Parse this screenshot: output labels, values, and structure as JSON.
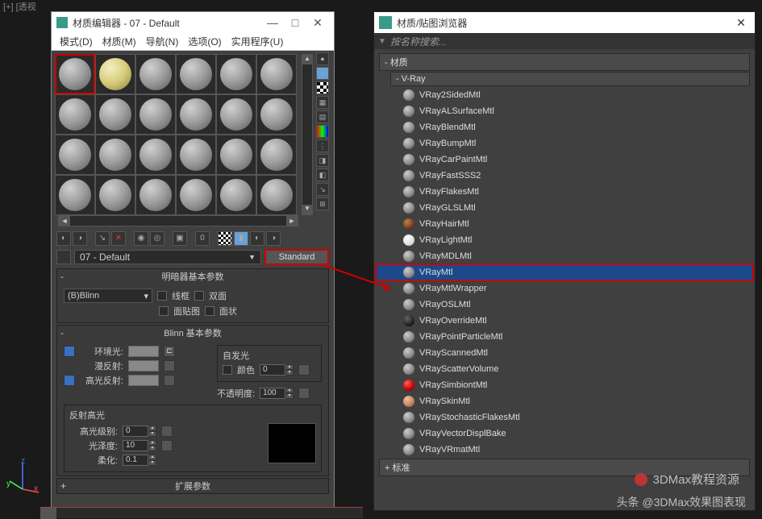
{
  "topbar": "[+] [透视",
  "matEditor": {
    "title": "材质编辑器 - 07 - Default",
    "winbtns": {
      "min": "—",
      "max": "□",
      "close": "✕"
    },
    "menu": [
      "模式(D)",
      "材质(M)",
      "导航(N)",
      "选项(O)",
      "实用程序(U)"
    ],
    "matName": "07 - Default",
    "stdButton": "Standard",
    "rollout1": {
      "title": "明暗器基本参数",
      "shader": "(B)Blinn",
      "opts": {
        "wireframe": "线框",
        "twoSided": "双面",
        "faceMap": "面贴图",
        "faceted": "面状"
      }
    },
    "rollout2": {
      "title": "Blinn 基本参数",
      "ambient": "环境光:",
      "diffuse": "漫反射:",
      "specular": "高光反射:",
      "selfIllum": {
        "title": "自发光",
        "colorLabel": "颜色",
        "value": "0"
      },
      "opacity": {
        "label": "不透明度:",
        "value": "100"
      },
      "specGroup": {
        "title": "反射高光",
        "level": {
          "label": "高光级别:",
          "value": "0"
        },
        "gloss": {
          "label": "光泽度:",
          "value": "10"
        },
        "soften": {
          "label": "柔化:",
          "value": "0.1"
        }
      }
    },
    "rollout3": {
      "title": "扩展参数"
    }
  },
  "browser": {
    "title": "材质/贴图浏览器",
    "searchPlaceholder": "按名称搜索...",
    "cat1": "- 材质",
    "cat2": "- V-Ray",
    "items": [
      "VRay2SidedMtl",
      "VRayALSurfaceMtl",
      "VRayBlendMtl",
      "VRayBumpMtl",
      "VRayCarPaintMtl",
      "VRayFastSSS2",
      "VRayFlakesMtl",
      "VRayGLSLMtl",
      "VRayHairMtl",
      "VRayLightMtl",
      "VRayMDLMtl",
      "VRayMtl",
      "VRayMtlWrapper",
      "VRayOSLMtl",
      "VRayOverrideMtl",
      "VRayPointParticleMtl",
      "VRayScannedMtl",
      "VRayScatterVolume",
      "VRaySimbiontMtl",
      "VRaySkinMtl",
      "VRayStochasticFlakesMtl",
      "VRayVectorDisplBake",
      "VRayVRmatMtl"
    ],
    "cat3": "+ 标准"
  },
  "watermark1": "头条 @3DMax效果图表现",
  "watermark2": "3DMax教程资源",
  "gizmo": {
    "x": "x",
    "y": "y",
    "z": "z"
  }
}
